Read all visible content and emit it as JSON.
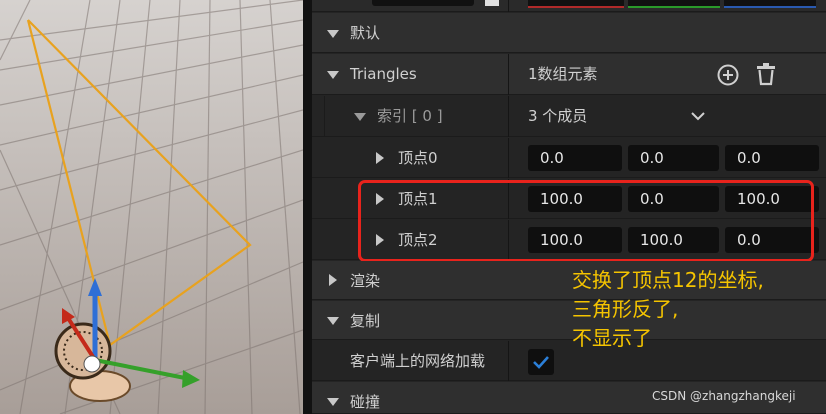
{
  "sections": {
    "default": "默认",
    "triangles": "Triangles",
    "render": "渲染",
    "replication": "复制",
    "collision": "碰撞"
  },
  "triangles": {
    "count_text": "1数组元素",
    "index_label": "索引 [ 0 ]",
    "index_members": "3 个成员",
    "vertices": [
      {
        "label": "顶点0",
        "values": [
          "0.0",
          "0.0",
          "0.0"
        ]
      },
      {
        "label": "顶点1",
        "values": [
          "100.0",
          "0.0",
          "100.0"
        ]
      },
      {
        "label": "顶点2",
        "values": [
          "100.0",
          "100.0",
          "0.0"
        ]
      }
    ]
  },
  "replication": {
    "net_load_label": "客户端上的网络加载",
    "net_load_checked": true
  },
  "annotation": {
    "line1": "交换了顶点12的坐标,",
    "line2": "三角形反了,",
    "line3": "不显示了"
  },
  "watermark": "CSDN @zhangzhangkeji",
  "colors": {
    "highlight_box": "#e8231c",
    "annotation_text": "#f5c400",
    "triangle_outline": "#e8a21f",
    "checkbox_accent": "#2b7fd8"
  },
  "icons": [
    "add-icon",
    "delete-icon",
    "chevron-down-icon",
    "checkmark-icon",
    "transform-gizmo-icon"
  ]
}
